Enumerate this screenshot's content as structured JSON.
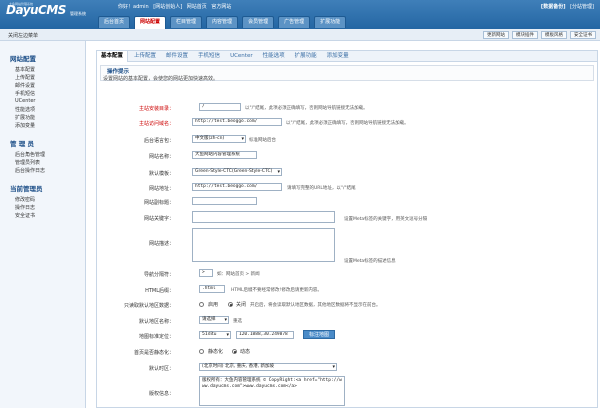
{
  "header": {
    "logo": "DayuCMS",
    "logo_sub": "大鱼网站管理系统",
    "logo_tag": "管理系统",
    "welcome": [
      "你好！admin",
      "[网站创始人]",
      "网站首页",
      "官方网站"
    ],
    "top_links": [
      "[数据备份]",
      "[分站管理]"
    ],
    "tabs": [
      "后台首页",
      "网站配置",
      "栏目管理",
      "内容管理",
      "会员管理",
      "广告管理",
      "扩展功能"
    ],
    "active_tab": 1
  },
  "subbar": {
    "close_menu": "关闭左边菜单",
    "quick": [
      "更新网站",
      "模块插件",
      "模板风格",
      "安全证书"
    ]
  },
  "sidebar": {
    "groups": [
      {
        "title": "网站配置",
        "items": [
          "基本配置",
          "上传配置",
          "邮件设置",
          "手机短信",
          "UCenter",
          "性能选项",
          "扩展功能",
          "添加变量"
        ]
      },
      {
        "title": "管 理 员",
        "items": [
          "后台角色管理",
          "管理员列表",
          "后台操作日志"
        ]
      },
      {
        "title": "当前管理员",
        "items": [
          "修改密码",
          "操作日志",
          "安全证书"
        ]
      }
    ]
  },
  "content": {
    "tabs": [
      "基本配置",
      "上传配置",
      "邮件设置",
      "手机短信",
      "UCenter",
      "性能选项",
      "扩展功能",
      "添加变量"
    ],
    "active_tab": 0,
    "tip_title": "操作提示",
    "tip_text": "设置网站的基本配置，会使您的网站更加快速高效。"
  },
  "form": {
    "home_dir_label": "主站安装目录：",
    "home_dir_value": "/",
    "home_dir_hint": "以\"/\"结尾，此项必须正确填写，否则网站导航链接无法加载。",
    "home_url_label": "主站访问域名：",
    "home_url_value": "http://test.beoggo.com/",
    "home_url_hint": "以\"/\"结尾，此项必须正确填写，否则网站导航链接无法加载。",
    "lang_label": "后台语言包：",
    "lang_value": "中文版(zh-cn)",
    "lang_hint": "标准网站后台",
    "name_label": "网站名称：",
    "name_value": "大鱼网站内容管理系统",
    "tpl_label": "默认模板：",
    "tpl_value": "Green-Style-CTC(Green-Style-CTC)",
    "url_label": "网站地址：",
    "url_value": "http://test.beoggo.com/",
    "url_hint": "请填写完整的URL地址，以\"/\"结尾",
    "title_label": "网站副标题：",
    "kw_label": "网站关键字：",
    "kw_hint": "设置Meta标签的关键字，用英文逗号分隔",
    "desc_label": "网站描述：",
    "desc_hint": "设置Meta标签的描述信息",
    "sep_label": "导航分隔符：",
    "sep_value": ">",
    "sep_hint": "如：网站首页 > 新闻",
    "html_label": "HTML后缀：",
    "html_value": ".html",
    "html_hint": "HTML后缀不要经常修改!修改后请更新内容。",
    "area_label": "只读取默认地区数据：",
    "area_opt1": "启用",
    "area_opt2": "关闭",
    "area_hint": "开启后，将会读取默认地区数据，其他地区数据将不显示在前台。",
    "region_label": "默认地区名称：",
    "region_value": "请选择",
    "region_hint": "重选",
    "map_label": "地图标准定位：",
    "map_select": "51ditu",
    "map_value": "120.1888,30.249878",
    "map_btn": "标注地图",
    "static_label": "首页是否静态化：",
    "static_opt1": "静态化",
    "static_opt2": "动态",
    "tz_label": "默认时区：",
    "tz_value": "(北京时间) 北京, 重庆, 香港, 新加坡",
    "copy_label": "版权信息：",
    "copy_value": "版权所有：大鱼内容管理系统 © CopyRight:<a href=\"http://www.dayucms.com\">www.dayucms.com</a>"
  }
}
